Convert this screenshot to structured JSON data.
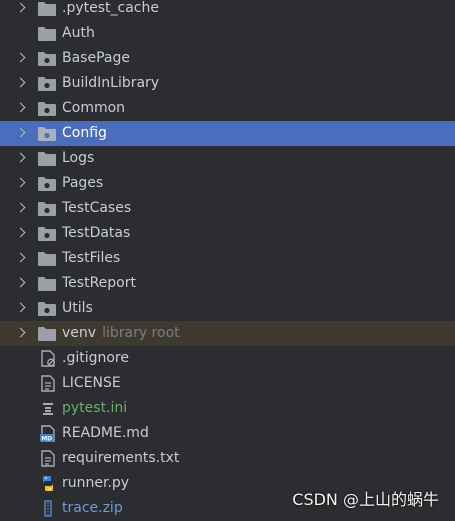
{
  "tree": {
    "items": [
      {
        "label": "pytest_cache_label",
        "text": ".pytest_cache",
        "icon": "folder-icon",
        "expandable": true
      },
      {
        "text": "Auth",
        "icon": "folder-icon",
        "expandable": false
      },
      {
        "text": "BasePage",
        "icon": "package-folder-icon",
        "expandable": true
      },
      {
        "text": "BuildInLibrary",
        "icon": "package-folder-icon",
        "expandable": true
      },
      {
        "text": "Common",
        "icon": "package-folder-icon",
        "expandable": true
      },
      {
        "text": "Config",
        "icon": "package-folder-icon",
        "expandable": true,
        "selected": true
      },
      {
        "text": "Logs",
        "icon": "folder-icon",
        "expandable": true
      },
      {
        "text": "Pages",
        "icon": "package-folder-icon",
        "expandable": true
      },
      {
        "text": "TestCases",
        "icon": "package-folder-icon",
        "expandable": true
      },
      {
        "text": "TestDatas",
        "icon": "package-folder-icon",
        "expandable": true
      },
      {
        "text": "TestFiles",
        "icon": "folder-icon",
        "expandable": true
      },
      {
        "text": "TestReport",
        "icon": "folder-icon",
        "expandable": true
      },
      {
        "text": "Utils",
        "icon": "package-folder-icon",
        "expandable": true
      },
      {
        "text": "venv",
        "hint": "library root",
        "icon": "folder-icon",
        "expandable": true,
        "library_root": true
      },
      {
        "text": ".gitignore",
        "icon": "gitignore-file-icon"
      },
      {
        "text": "LICENSE",
        "icon": "text-file-icon"
      },
      {
        "text": "pytest.ini",
        "icon": "ini-file-icon",
        "color": "#6aab73"
      },
      {
        "text": "README.md",
        "icon": "markdown-file-icon"
      },
      {
        "text": "requirements.txt",
        "icon": "text-file-icon"
      },
      {
        "text": "runner.py",
        "icon": "python-file-icon"
      },
      {
        "text": "trace.zip",
        "icon": "zip-file-icon",
        "color": "#6f9bd9"
      }
    ]
  },
  "watermark": "CSDN @上山的蜗牛",
  "colors": {
    "background": "#2b2d30",
    "selection": "#4a6dbd",
    "library_root_row": "#3f3a30",
    "folder": "#9aa0a6"
  }
}
